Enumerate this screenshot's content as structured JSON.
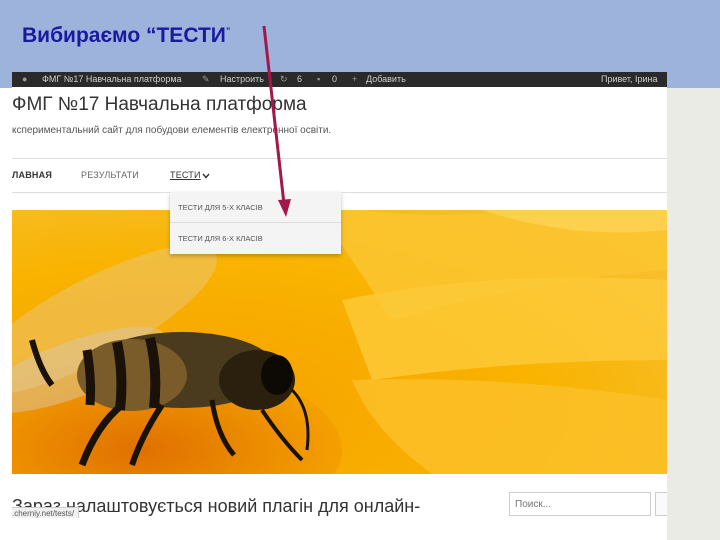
{
  "slide": {
    "title_main": "Вибираємо “ТЕСТИ",
    "title_tail": "”"
  },
  "adminbar": {
    "site_name": "ФМГ №17 Навчальна платформа",
    "customize": "Настроить",
    "updates": "6",
    "comments": "0",
    "add_new": "Добавить",
    "greeting": "Привет, Ірина"
  },
  "site": {
    "title": "ФМГ №17 Навчальна платформа",
    "tagline": "кспериментальний сайт для побудови елементів електронної освіти."
  },
  "nav": {
    "items": [
      {
        "label": "ЛАВНАЯ"
      },
      {
        "label": "РЕЗУЛЬТАТИ"
      },
      {
        "label": "ТЕСТИ"
      }
    ],
    "dropdown": [
      {
        "label": "ТЕСТИ ДЛЯ 5-Х КЛАСІВ"
      },
      {
        "label": "ТЕСТИ ДЛЯ 6-Х КЛАСІВ"
      }
    ]
  },
  "post": {
    "title": "Зараз налаштовується новий плагін для онлайн-"
  },
  "search": {
    "placeholder": "Поиск..."
  },
  "status": {
    "url": ".cherniy.net/tests/"
  },
  "colors": {
    "header_band": "#9db3dc",
    "title": "#1a1aa0",
    "arrow": "#a3174a",
    "adminbar": "#2a2a2a"
  },
  "icons": [
    "wordpress-icon",
    "brush-icon",
    "refresh-icon",
    "comment-icon",
    "plus-icon",
    "chevron-down-icon"
  ]
}
